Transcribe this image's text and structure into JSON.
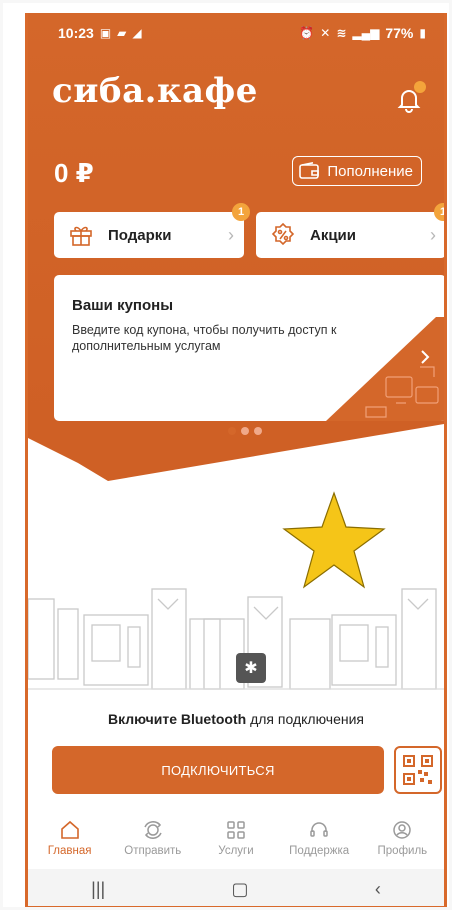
{
  "status": {
    "time": "10:23",
    "battery": "77%"
  },
  "brand": "сиба.кафе",
  "balance": "0 ₽",
  "topup_label": "Пополнение",
  "gifts": {
    "label": "Подарки",
    "badge": "1"
  },
  "promos": {
    "label": "Акции",
    "badge": "1"
  },
  "coupon": {
    "title": "Ваши купоны",
    "subtitle": "Введите код купона, чтобы получить доступ к дополнительным услугам"
  },
  "bluetooth": {
    "bold": "Включите Bluetooth",
    "rest": " для подключения"
  },
  "connect_label": "ПОДКЛЮЧИТЬСЯ",
  "tabs": [
    {
      "label": "Главная",
      "icon": "home-icon"
    },
    {
      "label": "Отправить",
      "icon": "send-icon"
    },
    {
      "label": "Услуги",
      "icon": "grid-icon"
    },
    {
      "label": "Поддержка",
      "icon": "headset-icon"
    },
    {
      "label": "Профиль",
      "icon": "profile-icon"
    }
  ],
  "colors": {
    "accent": "#d4672a",
    "badge": "#f3a43c",
    "star": "#f5c518"
  }
}
